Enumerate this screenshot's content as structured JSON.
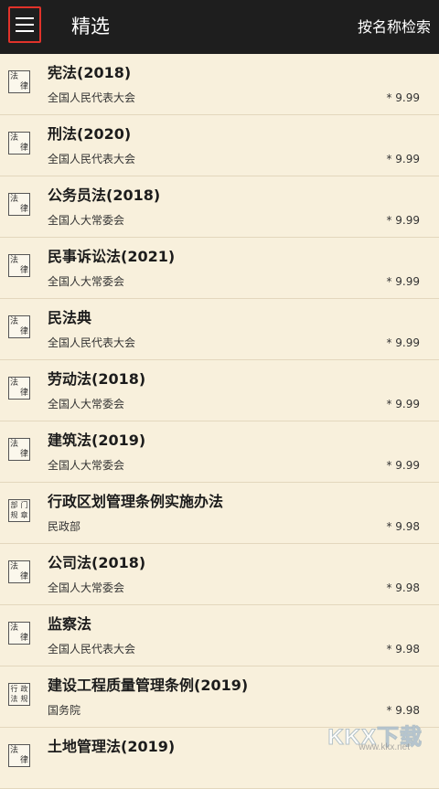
{
  "header": {
    "title": "精选",
    "search_label": "按名称检索"
  },
  "laws": [
    {
      "name": "宪法(2018)",
      "issuer": "全国人民代表大会",
      "rating": "* 9.99",
      "badge": [
        "法",
        "律"
      ],
      "badge_icon": "law-stamp-icon"
    },
    {
      "name": "刑法(2020)",
      "issuer": "全国人民代表大会",
      "rating": "* 9.99",
      "badge": [
        "法",
        "律"
      ],
      "badge_icon": "law-stamp-icon"
    },
    {
      "name": "公务员法(2018)",
      "issuer": "全国人大常委会",
      "rating": "* 9.99",
      "badge": [
        "法",
        "律"
      ],
      "badge_icon": "law-stamp-icon"
    },
    {
      "name": "民事诉讼法(2021)",
      "issuer": "全国人大常委会",
      "rating": "* 9.99",
      "badge": [
        "法",
        "律"
      ],
      "badge_icon": "law-stamp-icon"
    },
    {
      "name": "民法典",
      "issuer": "全国人民代表大会",
      "rating": "* 9.99",
      "badge": [
        "法",
        "律"
      ],
      "badge_icon": "law-stamp-icon"
    },
    {
      "name": "劳动法(2018)",
      "issuer": "全国人大常委会",
      "rating": "* 9.99",
      "badge": [
        "法",
        "律"
      ],
      "badge_icon": "law-stamp-icon"
    },
    {
      "name": "建筑法(2019)",
      "issuer": "全国人大常委会",
      "rating": "* 9.99",
      "badge": [
        "法",
        "律"
      ],
      "badge_icon": "law-stamp-icon"
    },
    {
      "name": "行政区划管理条例实施办法",
      "issuer": "民政部",
      "rating": "* 9.98",
      "badge": [
        "部",
        "门",
        "规",
        "章"
      ],
      "badge_icon": "department-rule-stamp-icon"
    },
    {
      "name": "公司法(2018)",
      "issuer": "全国人大常委会",
      "rating": "* 9.98",
      "badge": [
        "法",
        "律"
      ],
      "badge_icon": "law-stamp-icon"
    },
    {
      "name": "监察法",
      "issuer": "全国人民代表大会",
      "rating": "* 9.98",
      "badge": [
        "法",
        "律"
      ],
      "badge_icon": "law-stamp-icon"
    },
    {
      "name": "建设工程质量管理条例(2019)",
      "issuer": "国务院",
      "rating": "* 9.98",
      "badge": [
        "行",
        "政",
        "法",
        "规"
      ],
      "badge_icon": "admin-regulation-stamp-icon"
    },
    {
      "name": "土地管理法(2019)",
      "issuer": "",
      "rating": "",
      "badge": [
        "法",
        "律"
      ],
      "badge_icon": "law-stamp-icon"
    }
  ],
  "watermark": {
    "main": "KKX下载",
    "sub": "www.kkx.net"
  },
  "colors": {
    "topbar": "#1e1e1e",
    "background": "#f8f0dc",
    "highlight_border": "#e0322a"
  }
}
